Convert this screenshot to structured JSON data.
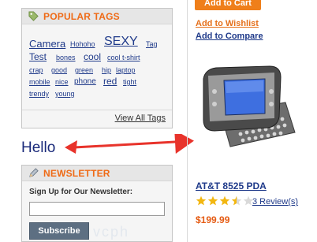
{
  "popular_tags": {
    "title": "POPULAR TAGS",
    "tags": [
      {
        "label": "Camera",
        "size": 13
      },
      {
        "label": "Hohoho",
        "size": 9
      },
      {
        "label": "SEXY",
        "size": 16
      },
      {
        "label": "Tag",
        "size": 9
      },
      {
        "label": "Test",
        "size": 12
      },
      {
        "label": "bones",
        "size": 9
      },
      {
        "label": "cool",
        "size": 12
      },
      {
        "label": "cool t-shirt",
        "size": 9
      },
      {
        "label": "crap",
        "size": 9
      },
      {
        "label": "good",
        "size": 9
      },
      {
        "label": "green",
        "size": 9
      },
      {
        "label": "hip",
        "size": 9
      },
      {
        "label": "laptop",
        "size": 9
      },
      {
        "label": "mobile",
        "size": 9
      },
      {
        "label": "nice",
        "size": 9
      },
      {
        "label": "phone",
        "size": 10
      },
      {
        "label": "red",
        "size": 12
      },
      {
        "label": "tight",
        "size": 9
      },
      {
        "label": "trendy",
        "size": 9
      },
      {
        "label": "young",
        "size": 9
      }
    ],
    "view_all": "View All Tags"
  },
  "annotation": {
    "text": "Hello"
  },
  "newsletter": {
    "title": "NEWSLETTER",
    "label": "Sign Up for Our Newsletter:",
    "input_value": "",
    "button": "Subscribe"
  },
  "product": {
    "add_to_cart": "Add to Cart",
    "add_to_wishlist": "Add to Wishlist",
    "add_to_compare": "Add to Compare",
    "name": "AT&T 8525 PDA",
    "rating": 3.5,
    "rating_max": 5,
    "reviews": "3 Review(s)",
    "price": "$199.99"
  },
  "watermark": "vcph",
  "colors": {
    "accent": "#ef6a16",
    "link": "#1f3a8a",
    "arrow": "#e8332b"
  }
}
